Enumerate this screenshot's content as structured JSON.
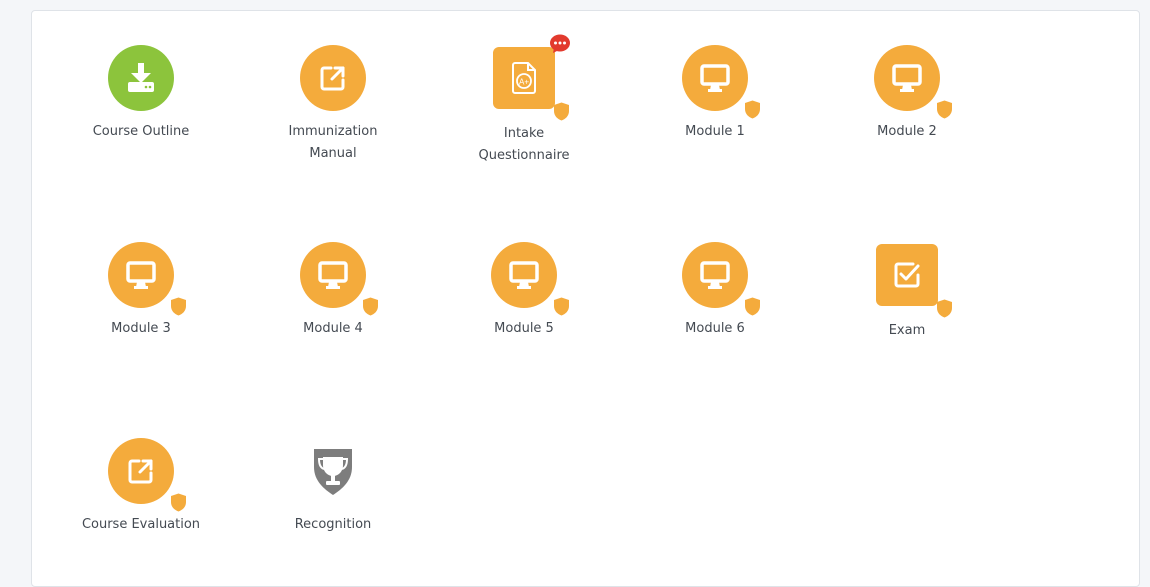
{
  "colors": {
    "accent": "#f4ab3c",
    "accent_dark": "#e89f2a",
    "green": "#8cc43c",
    "trophy": "#7d7d7d",
    "notification": "#e23a2e"
  },
  "items": [
    {
      "label": "Course Outline",
      "icon": "download-icon",
      "shape": "circle",
      "color": "#8cc43c",
      "shield": false,
      "notification": false
    },
    {
      "label": "Immunization Manual",
      "icon": "external-link-icon",
      "shape": "circle",
      "color": "#f4ab3c",
      "shield": false,
      "notification": false
    },
    {
      "label": "Intake Questionnaire",
      "icon": "graded-document-icon",
      "shape": "rounded",
      "color": "#f4ab3c",
      "shield": true,
      "notification": true
    },
    {
      "label": "Module 1",
      "icon": "monitor-icon",
      "shape": "circle",
      "color": "#f4ab3c",
      "shield": true,
      "notification": false
    },
    {
      "label": "Module 2",
      "icon": "monitor-icon",
      "shape": "circle",
      "color": "#f4ab3c",
      "shield": true,
      "notification": false
    },
    {
      "label": "Module 3",
      "icon": "monitor-icon",
      "shape": "circle",
      "color": "#f4ab3c",
      "shield": true,
      "notification": false
    },
    {
      "label": "Module 4",
      "icon": "monitor-icon",
      "shape": "circle",
      "color": "#f4ab3c",
      "shield": true,
      "notification": false
    },
    {
      "label": "Module 5",
      "icon": "monitor-icon",
      "shape": "circle",
      "color": "#f4ab3c",
      "shield": true,
      "notification": false
    },
    {
      "label": "Module 6",
      "icon": "monitor-icon",
      "shape": "circle",
      "color": "#f4ab3c",
      "shield": true,
      "notification": false
    },
    {
      "label": "Exam",
      "icon": "checkbox-icon",
      "shape": "rounded",
      "color": "#f4ab3c",
      "shield": true,
      "notification": false
    },
    {
      "label": "Course Evaluation",
      "icon": "external-link-icon",
      "shape": "circle",
      "color": "#f4ab3c",
      "shield": true,
      "notification": false
    },
    {
      "label": "Recognition",
      "icon": "trophy-icon",
      "shape": "plain",
      "color": "#7d7d7d",
      "shield": false,
      "notification": false
    }
  ]
}
